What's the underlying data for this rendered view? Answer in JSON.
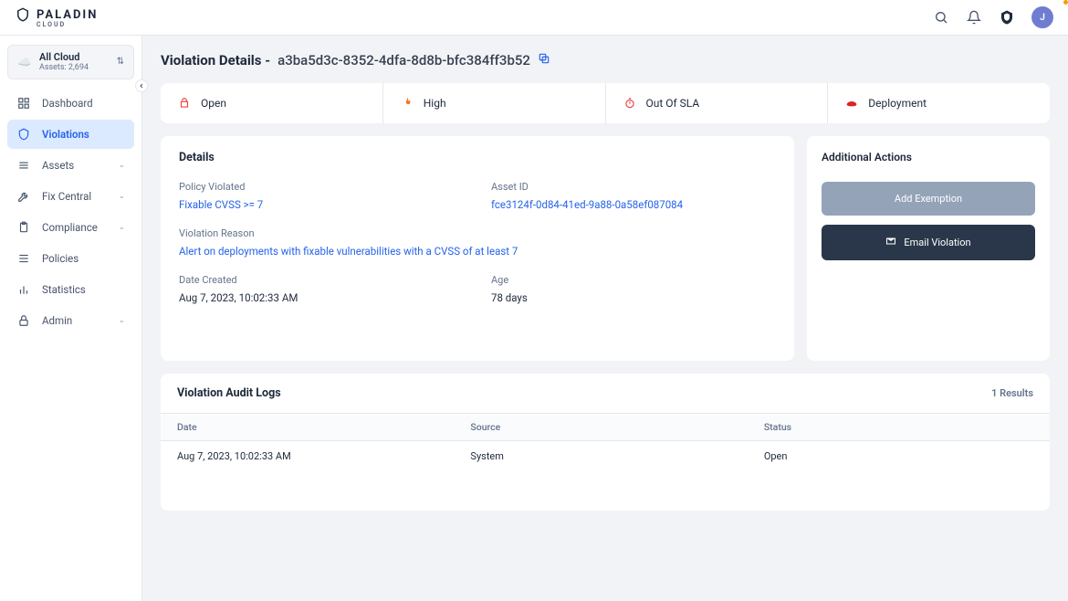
{
  "brand": {
    "name": "PALADIN",
    "sub": "CLOUD"
  },
  "header": {
    "avatar_initial": "J"
  },
  "scope": {
    "title": "All Cloud",
    "sub": "Assets: 2,694"
  },
  "sidebar": {
    "items": [
      {
        "label": "Dashboard",
        "icon": "dashboard"
      },
      {
        "label": "Violations",
        "icon": "shield",
        "active": true
      },
      {
        "label": "Assets",
        "icon": "stack",
        "chev": true
      },
      {
        "label": "Fix Central",
        "icon": "wrench",
        "chev": true
      },
      {
        "label": "Compliance",
        "icon": "clipboard",
        "chev": true
      },
      {
        "label": "Policies",
        "icon": "list"
      },
      {
        "label": "Statistics",
        "icon": "bars"
      },
      {
        "label": "Admin",
        "icon": "lock",
        "chev": true
      }
    ]
  },
  "page": {
    "title_prefix": "Violation Details -",
    "violation_id": "a3ba5d3c-8352-4dfa-8d8b-bfc384ff3b52"
  },
  "status": {
    "open": "Open",
    "severity": "High",
    "sla": "Out Of SLA",
    "resource": "Deployment"
  },
  "details": {
    "heading": "Details",
    "policy_label": "Policy Violated",
    "policy_value": "Fixable CVSS >= 7",
    "asset_label": "Asset ID",
    "asset_value": "fce3124f-0d84-41ed-9a88-0a58ef087084",
    "reason_label": "Violation Reason",
    "reason_value": "Alert on deployments with fixable vulnerabilities with a CVSS of at least 7",
    "date_label": "Date Created",
    "date_value": "Aug 7, 2023, 10:02:33 AM",
    "age_label": "Age",
    "age_value": "78 days"
  },
  "actions": {
    "heading": "Additional Actions",
    "add_exemption": "Add Exemption",
    "email_violation": "Email Violation"
  },
  "audit": {
    "heading": "Violation Audit Logs",
    "count_label": "1 Results",
    "columns": {
      "date": "Date",
      "source": "Source",
      "status": "Status"
    },
    "row": {
      "date": "Aug 7, 2023, 10:02:33 AM",
      "source": "System",
      "status": "Open"
    }
  }
}
